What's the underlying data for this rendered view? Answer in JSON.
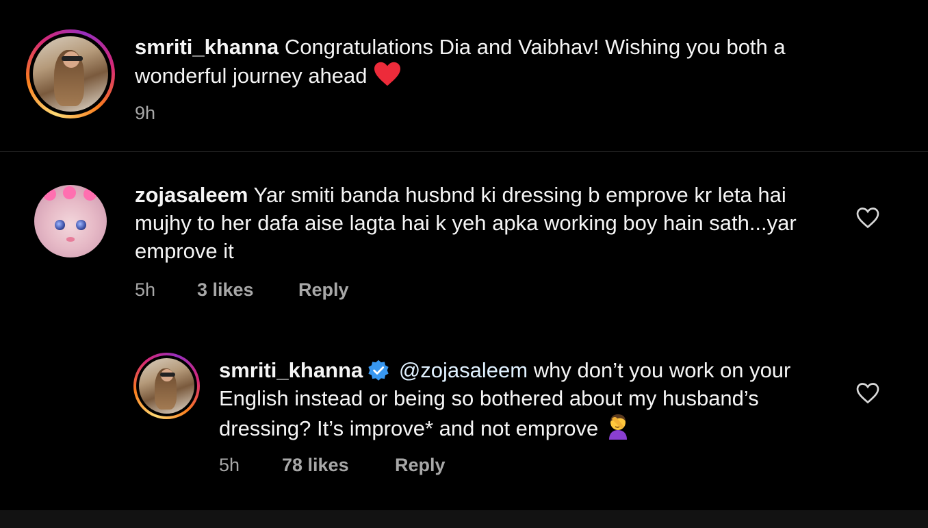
{
  "caption": {
    "username": "smriti_khanna",
    "text": "Congratulations Dia and Vaibhav! Wishing you both a wonderful journey ahead",
    "emoji": "red-heart-icon",
    "time": "9h"
  },
  "comments": [
    {
      "username": "zojasaleem",
      "text": "Yar smiti banda husbnd ki dressing b emprove kr leta hai mujhy to her dafa aise lagta hai k yeh apka working boy hain sath...yar emprove it",
      "time": "5h",
      "likes": "3 likes",
      "reply": "Reply"
    },
    {
      "username": "smriti_khanna",
      "verified": true,
      "mention": "@zojasaleem",
      "text": "why don’t you work on your English instead or being so bothered about my husband’s dressing? It’s improve* and not emprove",
      "emoji": "facepalm-icon",
      "time": "5h",
      "likes": "78 likes",
      "reply": "Reply"
    }
  ],
  "colors": {
    "background": "#000000",
    "text": "#f5f5f5",
    "muted": "#a8a8a8",
    "verified": "#3897f0",
    "heart": "#ed2b3a"
  }
}
